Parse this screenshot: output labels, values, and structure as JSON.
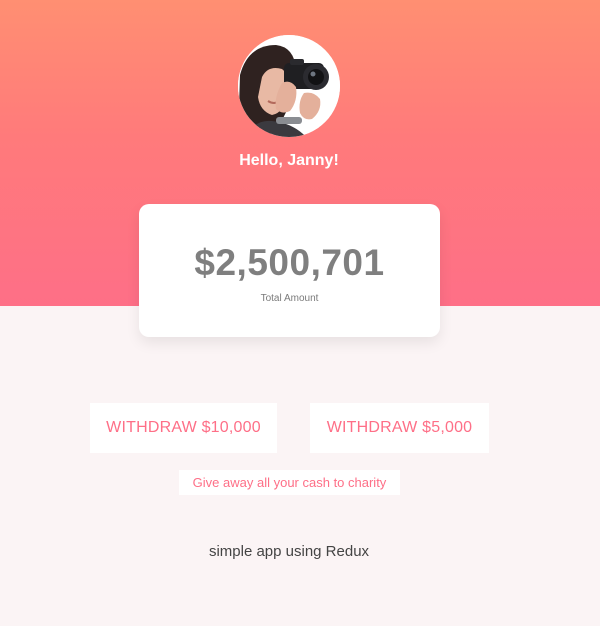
{
  "profile": {
    "greeting": "Hello, Janny!",
    "avatar_icon": "user-avatar-photo"
  },
  "balance": {
    "amount": "$2,500,701",
    "label": "Total Amount"
  },
  "actions": {
    "withdraw_10000": "WITHDRAW $10,000",
    "withdraw_5000": "WITHDRAW $5,000",
    "charity": "Give away all your cash to charity"
  },
  "footer": {
    "text": "simple app using Redux"
  },
  "colors": {
    "gradient_top": "#ff8f72",
    "gradient_bottom": "#fe6f87",
    "accent": "#fe6f87",
    "page_background": "#fbf4f5",
    "amount_text": "#7f7f7f"
  }
}
